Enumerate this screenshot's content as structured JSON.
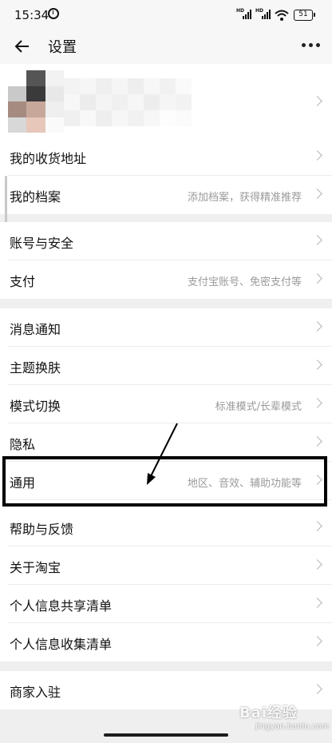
{
  "status_bar": {
    "time": "15:34",
    "network": "HD",
    "battery": "51"
  },
  "top_bar": {
    "title": "设置"
  },
  "sections": [
    {
      "rows": [
        {
          "label": "我的收货地址",
          "hint": ""
        },
        {
          "label": "我的档案",
          "hint": "添加档案，获得精准推荐"
        }
      ]
    },
    {
      "rows": [
        {
          "label": "账号与安全",
          "hint": ""
        },
        {
          "label": "支付",
          "hint": "支付宝账号、免密支付等"
        }
      ]
    },
    {
      "rows": [
        {
          "label": "消息通知",
          "hint": ""
        },
        {
          "label": "主题换肤",
          "hint": ""
        },
        {
          "label": "模式切换",
          "hint": "标准模式/长辈模式"
        },
        {
          "label": "隐私",
          "hint": ""
        },
        {
          "label": "通用",
          "hint": "地区、音效、辅助功能等"
        },
        {
          "label": "帮助与反馈",
          "hint": ""
        },
        {
          "label": "关于淘宝",
          "hint": ""
        },
        {
          "label": "个人信息共享清单",
          "hint": ""
        },
        {
          "label": "个人信息收集清单",
          "hint": ""
        }
      ]
    },
    {
      "rows": [
        {
          "label": "商家入驻",
          "hint": ""
        }
      ]
    }
  ],
  "watermark": {
    "brand": "Bai经验",
    "url": "jingyan.baidu.com"
  }
}
